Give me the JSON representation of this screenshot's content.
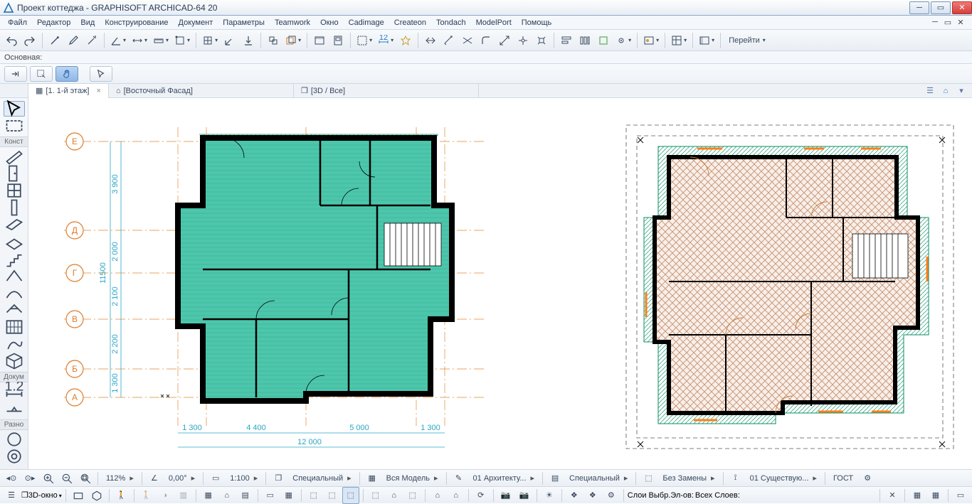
{
  "titlebar": {
    "text": "Проект коттеджа - GRAPHISOFT ARCHICAD-64 20"
  },
  "menu": {
    "items": [
      "Файл",
      "Редактор",
      "Вид",
      "Конструирование",
      "Документ",
      "Параметры",
      "Teamwork",
      "Окно",
      "Cadimage",
      "Createon",
      "Tondach",
      "ModelPort",
      "Помощь"
    ]
  },
  "toolbar_main": {
    "goto": "Перейти"
  },
  "subbar": {
    "label": "Основная:"
  },
  "tabs": {
    "items": [
      {
        "label": "[1. 1-й этаж]",
        "active": true,
        "closable": true,
        "icon": "plan"
      },
      {
        "label": "[Восточный Фасад]",
        "active": false,
        "closable": false,
        "icon": "elevation"
      },
      {
        "label": "[3D / Все]",
        "active": false,
        "closable": false,
        "icon": "cube"
      }
    ]
  },
  "toolbox": {
    "groups": [
      {
        "label": "",
        "tools": [
          "arrow",
          "marquee"
        ]
      },
      {
        "label": "Конст",
        "tools": [
          "wall",
          "door",
          "window",
          "column",
          "beam",
          "slab",
          "stair",
          "roof",
          "shell",
          "skylight",
          "curtain",
          "morph",
          "object"
        ]
      },
      {
        "label": "Докум",
        "tools": [
          "dim",
          "level"
        ]
      },
      {
        "label": "Разно",
        "tools": [
          "misc1",
          "misc2"
        ]
      }
    ]
  },
  "plan_left": {
    "axis_labels": [
      "Е",
      "Д",
      "Г",
      "В",
      "Б",
      "А"
    ],
    "dims_v": [
      "3 900",
      "2 000",
      "2 100",
      "2 200",
      "1 300"
    ],
    "dim_v_total": "11500",
    "dims_h": [
      "1 300",
      "4 400",
      "5 000",
      "1 300"
    ],
    "dim_h_total": "12 000"
  },
  "statusbar": {
    "zoom": "112%",
    "angle": "0,00°",
    "scale": "1:100",
    "f1": "Специальный",
    "f2": "Вся Модель",
    "f3": "01 Архитекту...",
    "f4": "Специальный",
    "f5": "Без Замены",
    "f6": "01 Существую...",
    "f7": "ГОСТ"
  },
  "iconbar": {
    "view3d": "3D-окно",
    "layers1": "Слои Выбр.Эл-ов:",
    "layers2": "Всех Слоев:"
  }
}
